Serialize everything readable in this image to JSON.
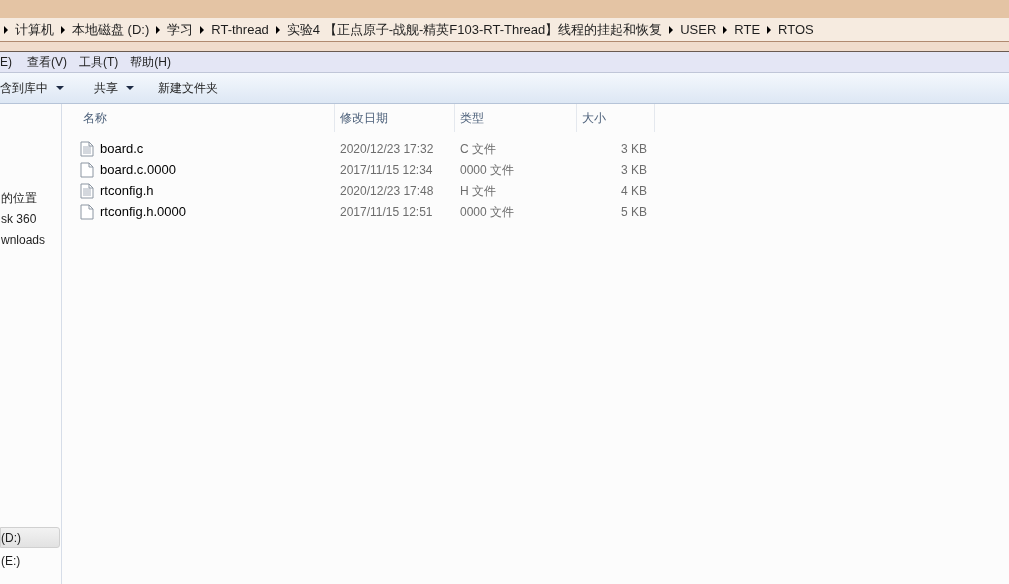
{
  "breadcrumb": [
    "计算机",
    "本地磁盘 (D:)",
    "学习",
    "RT-thread",
    "实验4 【正点原子-战舰-精英F103-RT-Thread】线程的挂起和恢复",
    "USER",
    "RTE",
    "RTOS"
  ],
  "menu": [
    "E)",
    "查看(V)",
    "工具(T)",
    "帮助(H)"
  ],
  "toolbar": [
    {
      "label": "含到库中",
      "dropdown": true
    },
    {
      "label": "共享",
      "dropdown": true
    },
    {
      "label": "新建文件夹",
      "dropdown": false
    }
  ],
  "sidebar": {
    "items": [
      {
        "label": "的位置",
        "selected": false
      },
      {
        "label": "sk 360",
        "selected": false
      },
      {
        "label": "wnloads",
        "selected": false
      },
      {
        "label": "(D:)",
        "selected": true
      },
      {
        "label": "(E:)",
        "selected": false
      }
    ]
  },
  "table": {
    "columns": [
      "名称",
      "修改日期",
      "类型",
      "大小"
    ],
    "rows": [
      {
        "name": "board.c",
        "date": "2020/12/23 17:32",
        "type": "C 文件",
        "size": "3 KB",
        "kind": "text"
      },
      {
        "name": "board.c.0000",
        "date": "2017/11/15 12:34",
        "type": "0000 文件",
        "size": "3 KB",
        "kind": "blank"
      },
      {
        "name": "rtconfig.h",
        "date": "2020/12/23 17:48",
        "type": "H 文件",
        "size": "4 KB",
        "kind": "text"
      },
      {
        "name": "rtconfig.h.0000",
        "date": "2017/11/15 12:51",
        "type": "0000 文件",
        "size": "5 KB",
        "kind": "blank"
      }
    ]
  }
}
